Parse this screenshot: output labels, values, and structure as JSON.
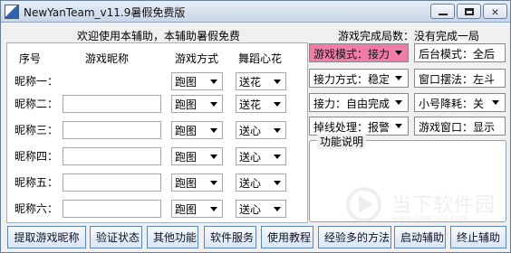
{
  "window": {
    "title": "NewYanTeam_v11.9暑假免费版",
    "icon": "app-icon"
  },
  "welcome": "欢迎使用本辅助，本辅助暑假免费",
  "status": "游戏完成局数：没有完成一局",
  "table": {
    "headers": {
      "seq": "序号",
      "nickname": "游戏昵称",
      "mode": "游戏方式",
      "flower": "舞蹈心花"
    },
    "rows": [
      {
        "label": "昵称一：",
        "mode": "跑图",
        "flower": "送花"
      },
      {
        "label": "昵称二：",
        "mode": "跑图",
        "flower": "送花"
      },
      {
        "label": "昵称三：",
        "mode": "跑图",
        "flower": "送心"
      },
      {
        "label": "昵称四：",
        "mode": "跑图",
        "flower": "送心"
      },
      {
        "label": "昵称五：",
        "mode": "跑图",
        "flower": "送心"
      },
      {
        "label": "昵称六：",
        "mode": "跑图",
        "flower": "送心"
      }
    ]
  },
  "settings": {
    "game_mode": "游戏模式：接力",
    "background_mode": "后台模式：全后",
    "relay_method": "接力方式：稳定",
    "window_layout": "窗口摆法：左斗",
    "relay": "接力：自由完成",
    "small_account_drop": "小号降耗：关",
    "disconnect_handling": "掉线处理：报警",
    "game_window": "游戏窗口：显示"
  },
  "function_description": {
    "title": "功能说明"
  },
  "buttons": [
    {
      "label": "提取游戏昵称"
    },
    {
      "label": "验证状态"
    },
    {
      "label": "其他功能"
    },
    {
      "label": "软件服务"
    },
    {
      "label": "使用教程"
    },
    {
      "label": "经验多的方法"
    },
    {
      "label": "启动辅助"
    },
    {
      "label": "终止辅助"
    }
  ],
  "watermark": {
    "text": "当下软件园",
    "url": "www.downxia.com"
  },
  "colors": {
    "accent": "#f17ca8",
    "window_background": "#f0f0f0",
    "button_border": "#5f86b1"
  }
}
